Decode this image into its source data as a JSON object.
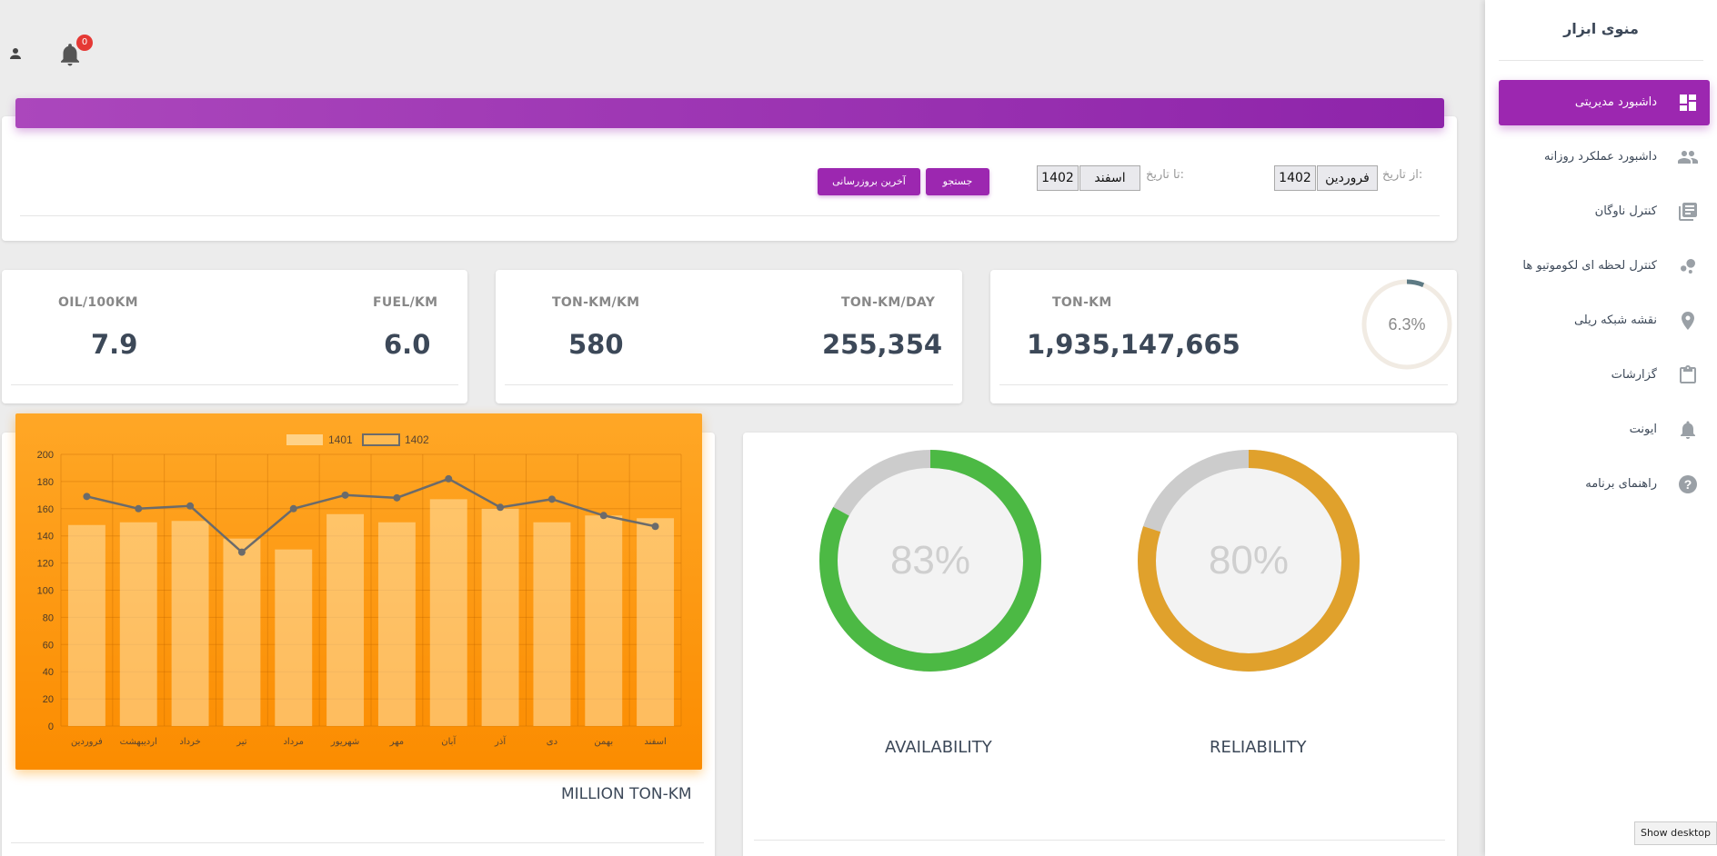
{
  "topbar": {
    "notification_count": "0"
  },
  "filter": {
    "from_label": "از تاریخ:",
    "from_month": "فروردین",
    "from_year": "1402",
    "to_label": "تا تاریخ:",
    "to_month": "اسفند",
    "to_year": "1402",
    "search_button": "جستجو",
    "latest_update_button": "آخرین بروزرسانی"
  },
  "stats": {
    "ton_km_label": "TON-KM",
    "ton_km_value": "1,935,147,665",
    "ton_km_percent": "6.3%",
    "ton_km_day_label": "TON-KM/DAY",
    "ton_km_day_value": "255,354",
    "ton_km_per_km_label": "TON-KM/KM",
    "ton_km_per_km_value": "580",
    "fuel_label": "FUEL/KM",
    "fuel_value": "6.0",
    "oil_label": "OIL/100KM",
    "oil_value": "7.9"
  },
  "chart_data": {
    "type": "bar",
    "title": "MILLION TON-KM",
    "categories": [
      "فروردین",
      "اردیبهشت",
      "خرداد",
      "تیر",
      "مرداد",
      "شهریور",
      "مهر",
      "آبان",
      "آذر",
      "دی",
      "بهمن",
      "اسفند"
    ],
    "series": [
      {
        "name": "1401",
        "type": "bar",
        "values": [
          148,
          150,
          151,
          138,
          130,
          156,
          150,
          167,
          160,
          150,
          155,
          153
        ]
      },
      {
        "name": "1402",
        "type": "line",
        "values": [
          169,
          160,
          162,
          128,
          160,
          170,
          168,
          182,
          161,
          167,
          155,
          147
        ]
      }
    ],
    "ylim": [
      0,
      200
    ],
    "yticks": [
      0,
      20,
      40,
      60,
      80,
      100,
      120,
      140,
      160,
      180,
      200
    ],
    "legend_position": "top",
    "grid": true
  },
  "gauges": {
    "availability": {
      "label": "AVAILABILITY",
      "percent_text": "83%",
      "value": 0.83,
      "color": "#4cb944"
    },
    "reliability": {
      "label": "RELIABILITY",
      "percent_text": "80%",
      "value": 0.8,
      "color": "#e0a12c"
    }
  },
  "sidebar": {
    "title": "منوی ابزار",
    "items": [
      {
        "label": "داشبورد مدیریتی",
        "icon": "dashboard-icon"
      },
      {
        "label": "داشبورد عملکرد روزانه",
        "icon": "people-icon"
      },
      {
        "label": "کنترل ناوگان",
        "icon": "list-icon"
      },
      {
        "label": "کنترل لحظه ای لکوموتیو ها",
        "icon": "bubble-chart-icon"
      },
      {
        "label": "نقشه شبکه ریلی",
        "icon": "location-pin-icon"
      },
      {
        "label": "گزارشات",
        "icon": "clipboard-icon"
      },
      {
        "label": "ایونت",
        "icon": "bell-icon"
      },
      {
        "label": "راهنمای برنامه",
        "icon": "help-icon"
      }
    ]
  },
  "taskbar": {
    "show_desktop": "Show desktop"
  }
}
